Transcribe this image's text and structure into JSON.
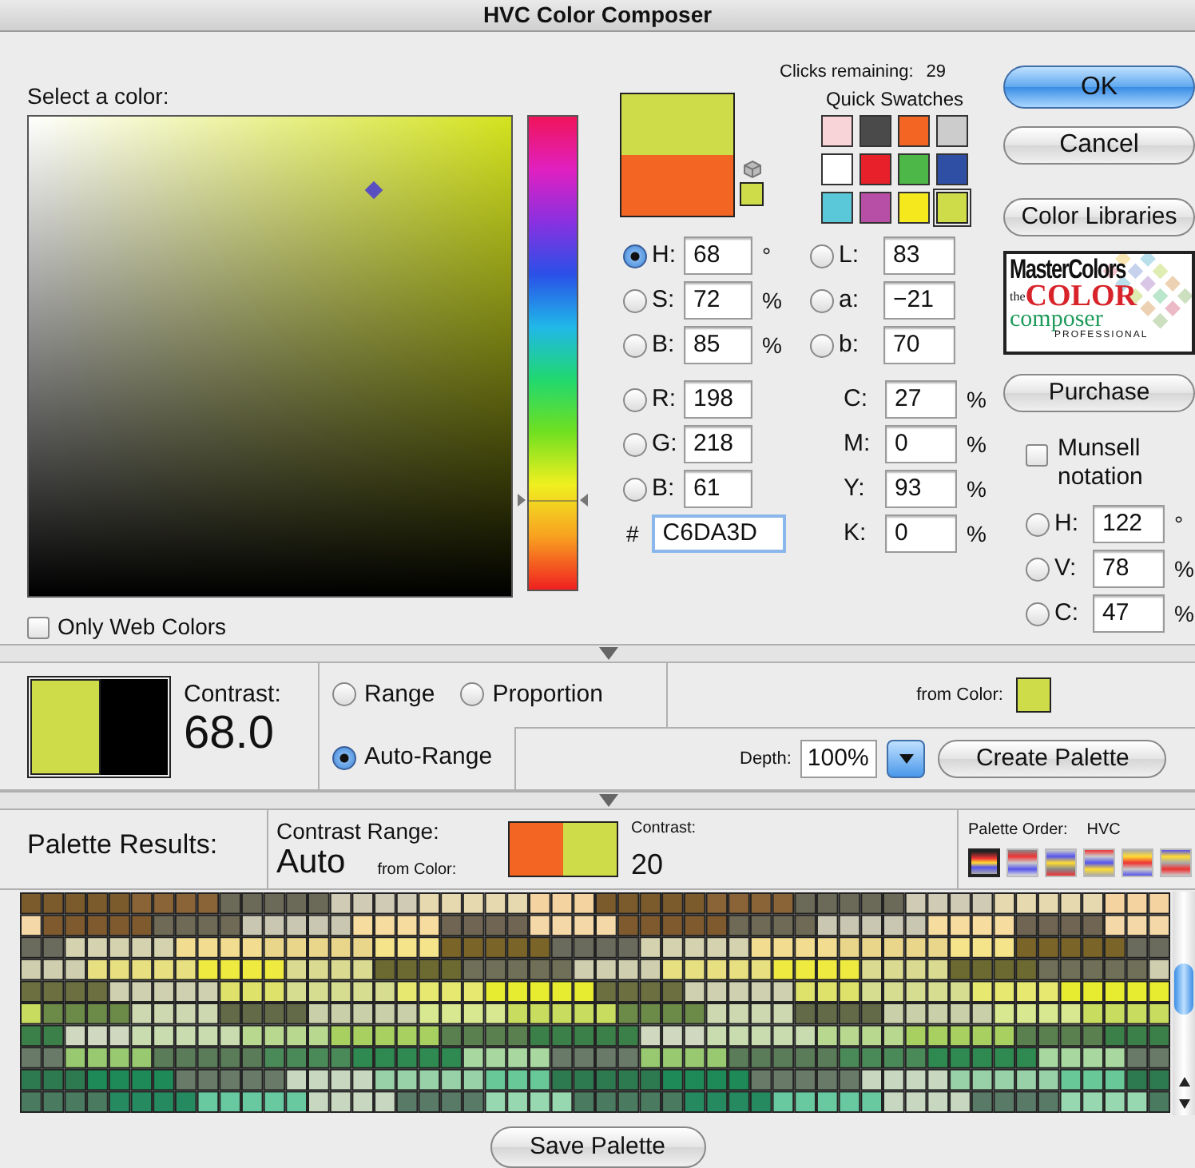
{
  "window": {
    "title": "HVC Color Composer"
  },
  "picker": {
    "label": "Select a color:"
  },
  "hue_slider": {
    "level": 0.19
  },
  "only_web_colors": {
    "label": "Only Web Colors",
    "checked": false
  },
  "clicks_remaining": {
    "label": "Clicks remaining:",
    "value": "29"
  },
  "quick_swatches": {
    "label": "Quick Swatches",
    "items": [
      {
        "color": "#f8d3d8",
        "selected": false
      },
      {
        "color": "#4a4a4a",
        "selected": false
      },
      {
        "color": "#f26522",
        "selected": false
      },
      {
        "color": "#cccccc",
        "selected": false
      },
      {
        "color": "#ffffff",
        "selected": false
      },
      {
        "color": "#e8202a",
        "selected": false
      },
      {
        "color": "#4db848",
        "selected": false
      },
      {
        "color": "#2e4fa3",
        "selected": false
      },
      {
        "color": "#5bc8d9",
        "selected": false
      },
      {
        "color": "#b84fa6",
        "selected": false
      },
      {
        "color": "#f5e81c",
        "selected": false
      },
      {
        "color": "#cfdc4a",
        "selected": true
      }
    ]
  },
  "hsb_fields": [
    {
      "label": "H:",
      "value": "68",
      "unit": "°",
      "selected": true
    },
    {
      "label": "S:",
      "value": "72",
      "unit": "%",
      "selected": false
    },
    {
      "label": "B:",
      "value": "85",
      "unit": "%",
      "selected": false
    }
  ],
  "lab_fields": [
    {
      "label": "L:",
      "value": "83",
      "selected": false
    },
    {
      "label": "a:",
      "value": "−21",
      "selected": false
    },
    {
      "label": "b:",
      "value": "70",
      "selected": false
    }
  ],
  "rgb_fields": [
    {
      "label": "R:",
      "value": "198",
      "selected": false
    },
    {
      "label": "G:",
      "value": "218",
      "selected": false
    },
    {
      "label": "B:",
      "value": "61",
      "selected": false
    }
  ],
  "cmyk_fields": [
    {
      "label": "C:",
      "value": "27",
      "unit": "%"
    },
    {
      "label": "M:",
      "value": "0",
      "unit": "%"
    },
    {
      "label": "Y:",
      "value": "93",
      "unit": "%"
    },
    {
      "label": "K:",
      "value": "0",
      "unit": "%"
    }
  ],
  "hex": {
    "prefix": "#",
    "value": "C6DA3D"
  },
  "buttons": {
    "ok": "OK",
    "cancel": "Cancel",
    "libraries": "Color Libraries",
    "purchase": "Purchase"
  },
  "logo": {
    "brand": "MasterColors",
    "small": "the",
    "title": "COLOR",
    "subtitle": "composer",
    "edition": "PROFESSIONAL"
  },
  "munsell": {
    "label": "Munsell notation",
    "checked": false,
    "fields": [
      {
        "label": "H:",
        "value": "122",
        "unit": "°",
        "selected": false
      },
      {
        "label": "V:",
        "value": "78",
        "unit": "%",
        "selected": false
      },
      {
        "label": "C:",
        "value": "47",
        "unit": "%",
        "selected": false
      }
    ]
  },
  "contrast": {
    "label": "Contrast:",
    "value": "68.0"
  },
  "modes": [
    {
      "label": "Range",
      "selected": false
    },
    {
      "label": "Proportion",
      "selected": false
    },
    {
      "label": "Auto-Range",
      "selected": true
    }
  ],
  "from_color_label": "from Color:",
  "depth": {
    "label": "Depth:",
    "value": "100%"
  },
  "create_button": "Create Palette",
  "results": {
    "title": "Palette Results:",
    "range_label": "Contrast Range:",
    "range_value": "Auto",
    "from_color_label": "from Color:",
    "contrast_label": "Contrast:",
    "contrast_value": "20",
    "order_label": "Palette Order:",
    "order_value": "HVC",
    "order_options": [
      {
        "selected": true
      },
      {
        "selected": false
      },
      {
        "selected": false
      },
      {
        "selected": false
      },
      {
        "selected": false
      },
      {
        "selected": false
      }
    ]
  },
  "save_button": "Save Palette"
}
